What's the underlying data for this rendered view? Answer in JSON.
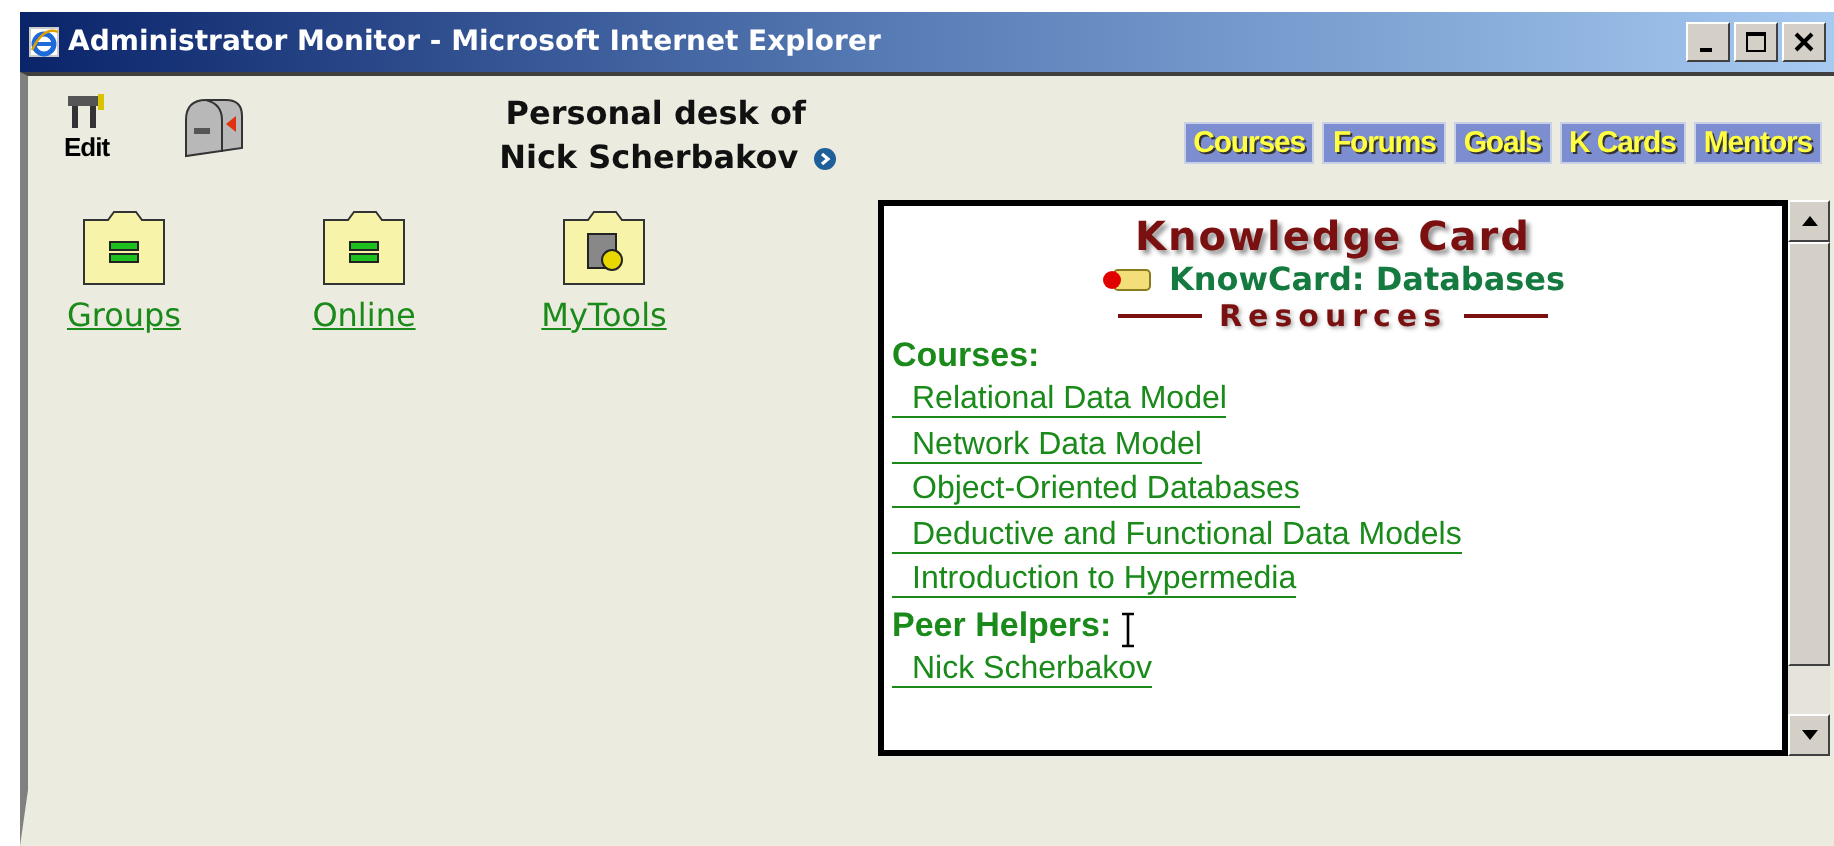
{
  "window": {
    "title": "Administrator Monitor - Microsoft Internet Explorer"
  },
  "toolbar": {
    "edit_label": "Edit"
  },
  "heading": {
    "line_1": "Personal desk of",
    "line_2": "Nick Scherbakov"
  },
  "nav_buttons": [
    "Courses",
    "Forums",
    "Goals",
    "K Cards",
    "Mentors"
  ],
  "folders": [
    {
      "label": "Groups",
      "kind": "list"
    },
    {
      "label": "Online",
      "kind": "list"
    },
    {
      "label": "MyTools",
      "kind": "tools"
    }
  ],
  "card": {
    "title": "Knowledge Card",
    "subtitle": "KnowCard: Databases",
    "section": "Resources",
    "groups": [
      {
        "heading": "Courses:",
        "links": [
          "Relational Data Model",
          "Network Data Model",
          "Object-Oriented Databases",
          "Deductive and Functional Data Models",
          "Introduction to Hypermedia"
        ]
      },
      {
        "heading": "Peer Helpers:",
        "links": [
          "Nick Scherbakov"
        ]
      }
    ]
  }
}
